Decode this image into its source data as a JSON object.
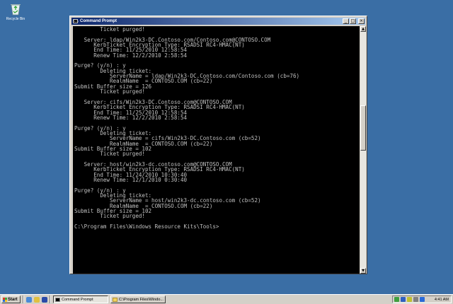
{
  "desktop": {
    "recycle_bin_label": "Recycle Bin"
  },
  "window": {
    "title": "Command Prompt",
    "icon_text": "C:\\",
    "minimize": "_",
    "maximize": "□",
    "close": "×"
  },
  "console": {
    "lines": [
      "        Ticket purged!",
      "",
      "   Server: ldap/Win2k3-DC.Contoso.com/Contoso.com@CONTOSO.COM",
      "      KerbTicket Encryption Type: RSADSI RC4-HMAC(NT)",
      "      End Time: 11/25/2010 12:58:54",
      "      Renew Time: 12/2/2010 2:58:54",
      "",
      "Purge? (y/n) : y",
      "        Deleting ticket:",
      "           ServerName = ldap/Win2k3-DC.Contoso.com/Contoso.com (cb=76)",
      "           RealmName  = CONTOSO.COM (cb=22)",
      "Submit Buffer size = 126",
      "        Ticket purged!",
      "",
      "   Server: cifs/Win2k3-DC.Contoso.com@CONTOSO.COM",
      "      KerbTicket Encryption Type: RSADSI RC4-HMAC(NT)",
      "      End Time: 11/25/2010 12:58:54",
      "      Renew Time: 12/2/2010 2:58:54",
      "",
      "Purge? (y/n) : y",
      "        Deleting ticket:",
      "           ServerName = cifs/Win2k3-DC.Contoso.com (cb=52)",
      "           RealmName  = CONTOSO.COM (cb=22)",
      "Submit Buffer size = 102",
      "        Ticket purged!",
      "",
      "   Server: host/win2k3-dc.contoso.com@CONTOSO.COM",
      "      KerbTicket Encryption Type: RSADSI RC4-HMAC(NT)",
      "      End Time: 11/24/2010 10:30:40",
      "      Renew Time: 12/1/2010 0:30:40",
      "",
      "Purge? (y/n) : y",
      "        Deleting ticket:",
      "           ServerName = host/win2k3-dc.contoso.com (cb=52)",
      "           RealmName  = CONTOSO.COM (cb=22)",
      "Submit Buffer size = 102",
      "        Ticket purged!",
      "",
      "C:\\Program Files\\Windows Resource Kits\\Tools>"
    ]
  },
  "taskbar": {
    "start_label": "Start",
    "tasks": [
      {
        "label": "Command Prompt"
      },
      {
        "label": "C:\\Program Files\\Windo..."
      }
    ],
    "clock": "4:41 AM"
  },
  "colors": {
    "desktop": "#3a6ea5",
    "console_bg": "#000000",
    "console_fg": "#c0c0c0",
    "title_active": "#0a246a"
  }
}
